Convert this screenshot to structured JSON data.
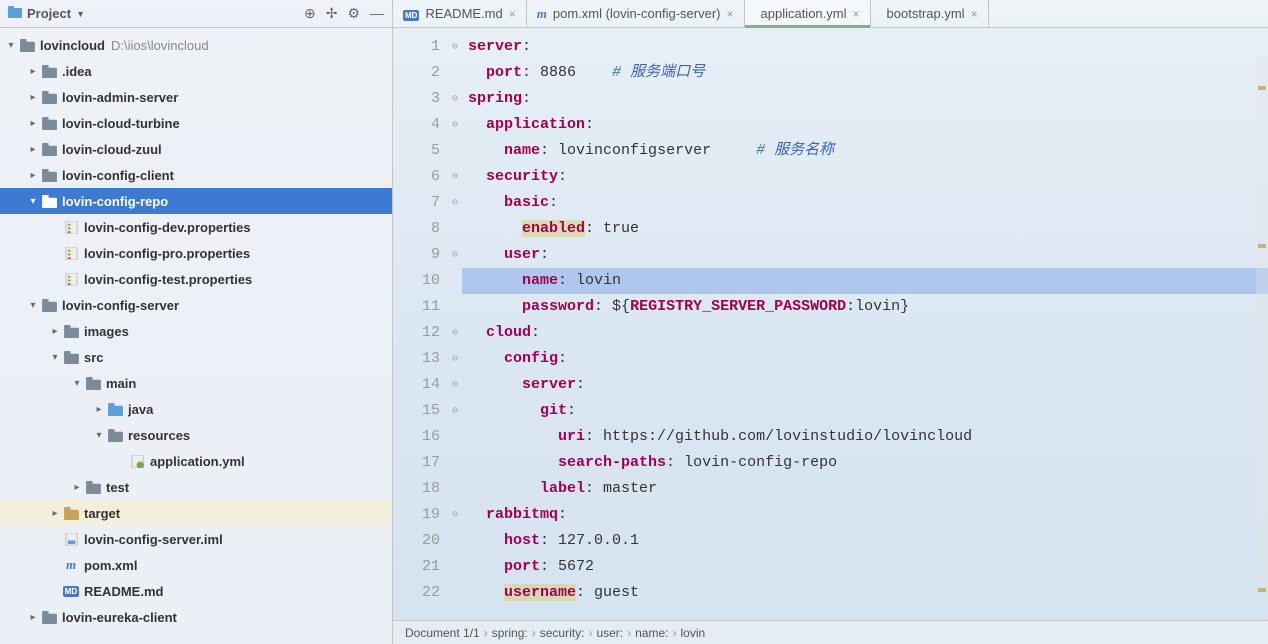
{
  "panel": {
    "title": "Project"
  },
  "project": {
    "root": {
      "name": "lovincloud",
      "path": "D:\\iios\\lovincloud"
    },
    "nodes": [
      {
        "depth": 1,
        "chev": ">",
        "icon": "folder",
        "label": ".idea"
      },
      {
        "depth": 1,
        "chev": ">",
        "icon": "folder",
        "label": "lovin-admin-server"
      },
      {
        "depth": 1,
        "chev": ">",
        "icon": "folder",
        "label": "lovin-cloud-turbine"
      },
      {
        "depth": 1,
        "chev": ">",
        "icon": "folder",
        "label": "lovin-cloud-zuul"
      },
      {
        "depth": 1,
        "chev": ">",
        "icon": "folder",
        "label": "lovin-config-client"
      },
      {
        "depth": 1,
        "chev": "v",
        "icon": "folder",
        "label": "lovin-config-repo",
        "selected": true
      },
      {
        "depth": 2,
        "chev": "",
        "icon": "prop",
        "label": "lovin-config-dev.properties"
      },
      {
        "depth": 2,
        "chev": "",
        "icon": "prop",
        "label": "lovin-config-pro.properties"
      },
      {
        "depth": 2,
        "chev": "",
        "icon": "prop",
        "label": "lovin-config-test.properties"
      },
      {
        "depth": 1,
        "chev": "v",
        "icon": "folder",
        "label": "lovin-config-server"
      },
      {
        "depth": 2,
        "chev": ">",
        "icon": "folder",
        "label": "images"
      },
      {
        "depth": 2,
        "chev": "v",
        "icon": "folder",
        "label": "src"
      },
      {
        "depth": 3,
        "chev": "v",
        "icon": "folder",
        "label": "main"
      },
      {
        "depth": 4,
        "chev": ">",
        "icon": "folder-b",
        "label": "java"
      },
      {
        "depth": 4,
        "chev": "v",
        "icon": "folder",
        "label": "resources"
      },
      {
        "depth": 5,
        "chev": "",
        "icon": "yml",
        "label": "application.yml"
      },
      {
        "depth": 3,
        "chev": ">",
        "icon": "folder",
        "label": "test"
      },
      {
        "depth": 2,
        "chev": ">",
        "icon": "folder-o",
        "label": "target",
        "target": true
      },
      {
        "depth": 2,
        "chev": "",
        "icon": "iml",
        "label": "lovin-config-server.iml"
      },
      {
        "depth": 2,
        "chev": "",
        "icon": "xml",
        "label": "pom.xml"
      },
      {
        "depth": 2,
        "chev": "",
        "icon": "md",
        "label": "README.md"
      },
      {
        "depth": 1,
        "chev": ">",
        "icon": "folder",
        "label": "lovin-eureka-client"
      }
    ]
  },
  "tabs": [
    {
      "icon": "md",
      "label": "README.md",
      "active": false
    },
    {
      "icon": "xml",
      "label": "pom.xml (lovin-config-server)",
      "active": false
    },
    {
      "icon": "yml",
      "label": "application.yml",
      "active": true
    },
    {
      "icon": "yml",
      "label": "bootstrap.yml",
      "active": false
    }
  ],
  "code": {
    "hl_line": 10,
    "lines": [
      {
        "n": 1,
        "ind": 0,
        "key": "server",
        "colon": ":"
      },
      {
        "n": 2,
        "ind": 1,
        "key": "port",
        "colon": ": ",
        "val": "8886",
        "comment": "    # 服务端口号"
      },
      {
        "n": 3,
        "ind": 0,
        "key": "spring",
        "colon": ":"
      },
      {
        "n": 4,
        "ind": 1,
        "key": "application",
        "colon": ":"
      },
      {
        "n": 5,
        "ind": 2,
        "key": "name",
        "colon": ": ",
        "val": "lovinconfigserver",
        "comment": "     # 服务名称"
      },
      {
        "n": 6,
        "ind": 1,
        "key": "security",
        "colon": ":"
      },
      {
        "n": 7,
        "ind": 2,
        "key": "basic",
        "colon": ":"
      },
      {
        "n": 8,
        "ind": 3,
        "key": "enabled",
        "colon": ": ",
        "val": "true",
        "warn": true
      },
      {
        "n": 9,
        "ind": 2,
        "key": "user",
        "colon": ":"
      },
      {
        "n": 10,
        "ind": 3,
        "key": "name",
        "colon": ": ",
        "val": "lovin"
      },
      {
        "n": 11,
        "ind": 3,
        "key": "password",
        "colon": ": ",
        "raw": "${",
        "var": "REGISTRY_SERVER_PASSWORD",
        "raw2": ":lovin}"
      },
      {
        "n": 12,
        "ind": 1,
        "key": "cloud",
        "colon": ":"
      },
      {
        "n": 13,
        "ind": 2,
        "key": "config",
        "colon": ":"
      },
      {
        "n": 14,
        "ind": 3,
        "key": "server",
        "colon": ":"
      },
      {
        "n": 15,
        "ind": 4,
        "key": "git",
        "colon": ":"
      },
      {
        "n": 16,
        "ind": 5,
        "key": "uri",
        "colon": ": ",
        "val": "https://github.com/lovinstudio/lovincloud"
      },
      {
        "n": 17,
        "ind": 5,
        "key": "search-paths",
        "colon": ": ",
        "val": "lovin-config-repo"
      },
      {
        "n": 18,
        "ind": 4,
        "key": "label",
        "colon": ": ",
        "val": "master"
      },
      {
        "n": 19,
        "ind": 1,
        "key": "rabbitmq",
        "colon": ":"
      },
      {
        "n": 20,
        "ind": 2,
        "key": "host",
        "colon": ": ",
        "val": "127.0.0.1"
      },
      {
        "n": 21,
        "ind": 2,
        "key": "port",
        "colon": ": ",
        "val": "5672"
      },
      {
        "n": 22,
        "ind": 2,
        "key": "username",
        "colon": ": ",
        "val": "guest",
        "warn": true
      }
    ]
  },
  "breadcrumb": [
    "Document 1/1",
    "spring:",
    "security:",
    "user:",
    "name:",
    "lovin"
  ]
}
